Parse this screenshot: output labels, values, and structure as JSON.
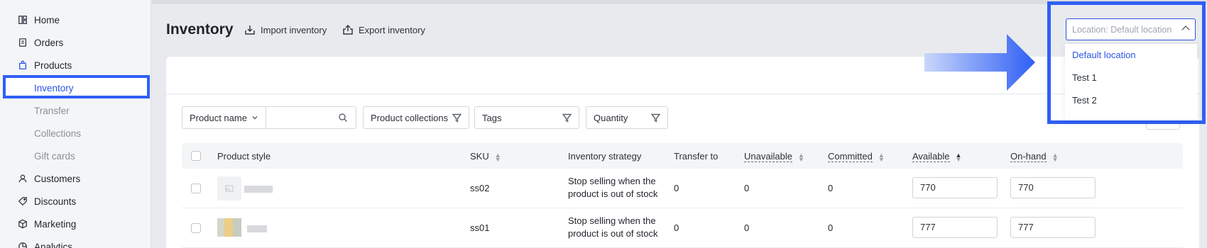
{
  "sidebar": {
    "items": [
      {
        "label": "Home",
        "icon": "home-icon"
      },
      {
        "label": "Orders",
        "icon": "orders-icon"
      },
      {
        "label": "Products",
        "icon": "bag-icon"
      }
    ],
    "sub_items": [
      {
        "label": "Inventory"
      },
      {
        "label": "Transfer"
      },
      {
        "label": "Collections"
      },
      {
        "label": "Gift cards"
      }
    ],
    "bottom_items": [
      {
        "label": "Customers",
        "icon": "person-icon"
      },
      {
        "label": "Discounts",
        "icon": "tag-icon"
      },
      {
        "label": "Marketing",
        "icon": "cube-icon"
      },
      {
        "label": "Analytics",
        "icon": "chart-icon"
      }
    ]
  },
  "header": {
    "title": "Inventory",
    "import_label": "Import inventory",
    "export_label": "Export inventory"
  },
  "location": {
    "placeholder": "Location: Default location",
    "options": [
      "Default location",
      "Test 1",
      "Test 2"
    ],
    "selected": "Default location"
  },
  "filters": {
    "product_name": "Product name",
    "search_value": "",
    "collections": "Product collections",
    "tags": "Tags",
    "quantity": "Quantity"
  },
  "table": {
    "columns": [
      "Product style",
      "SKU",
      "Inventory strategy",
      "Transfer to",
      "Unavailable",
      "Committed",
      "Available",
      "On-hand"
    ],
    "rows": [
      {
        "sku": "ss02",
        "strategy_line1": "Stop selling when the",
        "strategy_line2": "product is out of stock",
        "transfer_to": "0",
        "unavailable": "0",
        "committed": "0",
        "available": "770",
        "on_hand": "770"
      },
      {
        "sku": "ss01",
        "strategy_line1": "Stop selling when the",
        "strategy_line2": "product is out of stock",
        "transfer_to": "0",
        "unavailable": "0",
        "committed": "0",
        "available": "777",
        "on_hand": "777"
      }
    ]
  },
  "colors": {
    "accent": "#2b55e6",
    "highlight": "#2f5ff5"
  }
}
